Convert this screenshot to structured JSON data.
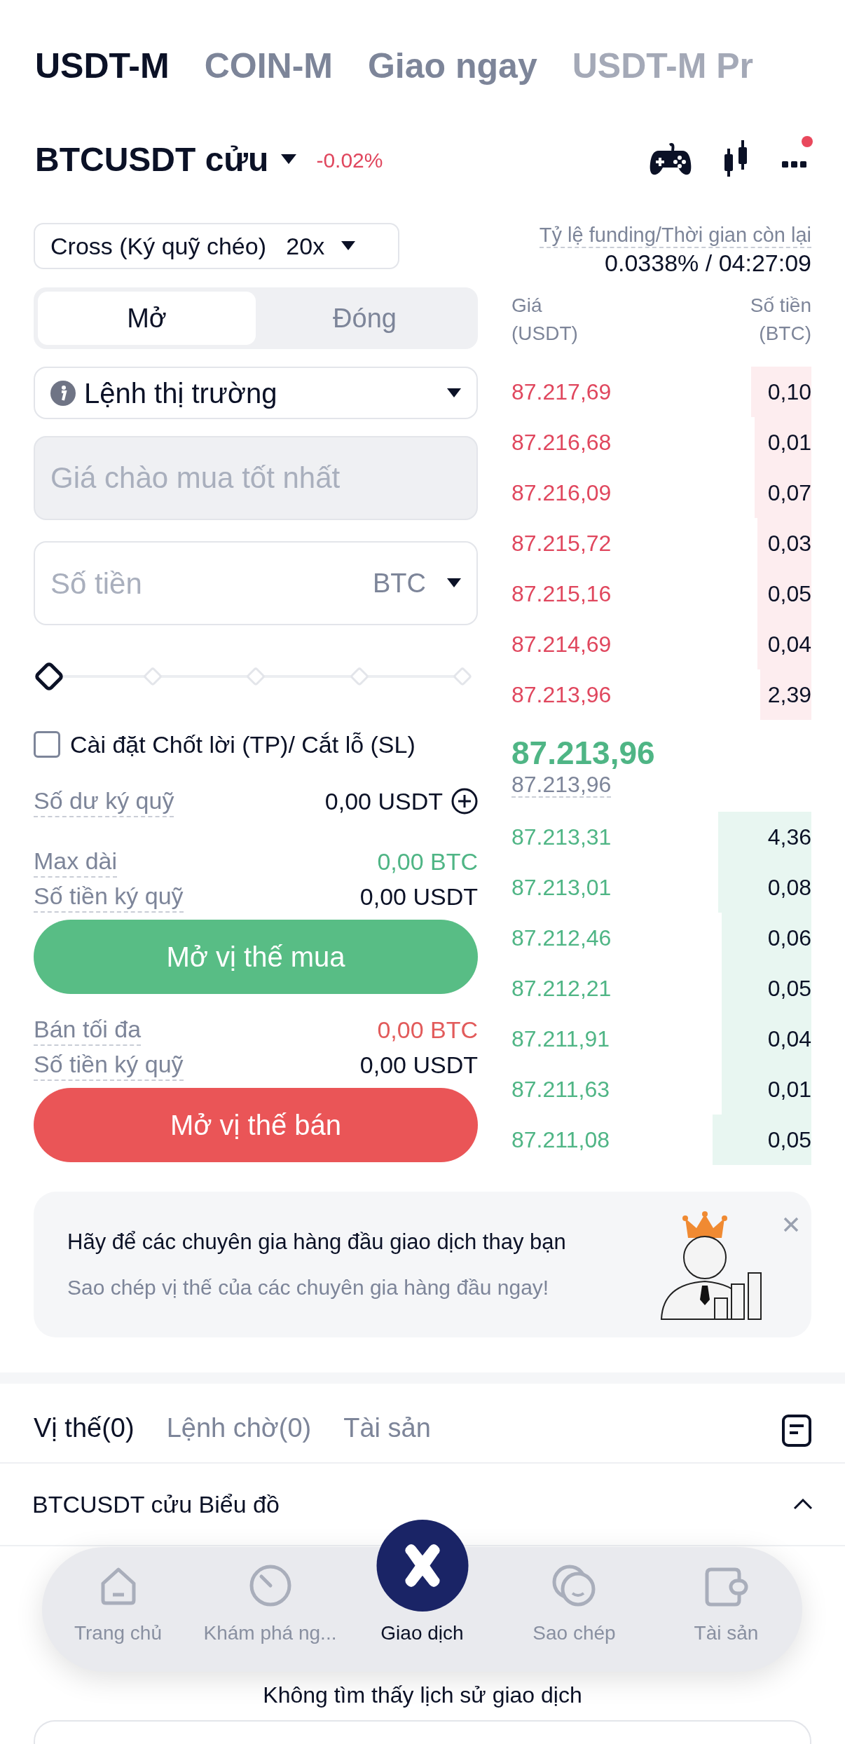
{
  "market_tabs": [
    {
      "label": "USDT-M",
      "selected": true
    },
    {
      "label": "COIN-M",
      "selected": false
    },
    {
      "label": "Giao ngay",
      "selected": false
    },
    {
      "label": "USDT-M Pr",
      "selected": false
    }
  ],
  "symbol": {
    "name": "BTCUSDT cửu",
    "change": "-0.02%"
  },
  "toolbar": {
    "notification_dot": true
  },
  "margin_mode": {
    "label": "Cross (Ký quỹ chéo)",
    "leverage": "20x"
  },
  "funding": {
    "label": "Tỷ lệ funding/Thời gian còn lại",
    "value": "0.0338% / 04:27:09"
  },
  "side_tabs": [
    {
      "label": "Mở",
      "selected": true
    },
    {
      "label": "Đóng",
      "selected": false
    }
  ],
  "order_type": "Lệnh thị trường",
  "price_field": {
    "placeholder": "Giá chào mua tốt nhất",
    "disabled": true
  },
  "amount_field": {
    "placeholder": "Số tiền",
    "unit": "BTC"
  },
  "slider": {
    "level": 0
  },
  "tp_sl": {
    "label": "Cài đặt Chốt lời (TP)/ Cắt lỗ (SL)",
    "checked": false
  },
  "balance": {
    "label": "Số dư ký quỹ",
    "value": "0,00 USDT"
  },
  "buy": {
    "max_label": "Max dài",
    "max_value": "0,00 BTC",
    "margin_label": "Số tiền ký quỹ",
    "margin_value": "0,00 USDT",
    "button": "Mở vị thế mua"
  },
  "sell": {
    "max_label": "Bán tối đa",
    "max_value": "0,00 BTC",
    "margin_label": "Số tiền ký quỹ",
    "margin_value": "0,00 USDT",
    "button": "Mở vị thế bán"
  },
  "order_book": {
    "price_header": "Giá",
    "price_unit": "(USDT)",
    "amount_header": "Số tiền",
    "amount_unit": "(BTC)",
    "asks": [
      {
        "price": "87.217,69",
        "amount": "0,10",
        "level": 0.2
      },
      {
        "price": "87.216,68",
        "amount": "0,01",
        "level": 0.19
      },
      {
        "price": "87.216,09",
        "amount": "0,07",
        "level": 0.19
      },
      {
        "price": "87.215,72",
        "amount": "0,03",
        "level": 0.18
      },
      {
        "price": "87.215,16",
        "amount": "0,05",
        "level": 0.18
      },
      {
        "price": "87.214,69",
        "amount": "0,04",
        "level": 0.18
      },
      {
        "price": "87.213,96",
        "amount": "2,39",
        "level": 0.17
      }
    ],
    "last_price": "87.213,96",
    "mark_price": "87.213,96",
    "bids": [
      {
        "price": "87.213,31",
        "amount": "4,36",
        "level": 0.31
      },
      {
        "price": "87.213,01",
        "amount": "0,08",
        "level": 0.31
      },
      {
        "price": "87.212,46",
        "amount": "0,06",
        "level": 0.3
      },
      {
        "price": "87.212,21",
        "amount": "0,05",
        "level": 0.3
      },
      {
        "price": "87.211,91",
        "amount": "0,04",
        "level": 0.3
      },
      {
        "price": "87.211,63",
        "amount": "0,01",
        "level": 0.3
      },
      {
        "price": "87.211,08",
        "amount": "0,05",
        "level": 0.33
      }
    ]
  },
  "banner": {
    "title": "Hãy để các chuyên gia hàng đầu giao dịch thay bạn",
    "subtitle": "Sao chép vị thế của các chuyên gia hàng đầu ngay!"
  },
  "position_tabs": [
    {
      "label": "Vị thế(0)",
      "selected": true
    },
    {
      "label": "Lệnh chờ(0)",
      "selected": false
    },
    {
      "label": "Tài sản",
      "selected": false
    }
  ],
  "chart_row": {
    "label": "BTCUSDT cửu Biểu đồ",
    "expanded": true
  },
  "empty_text": "Không tìm thấy lịch sử giao dịch",
  "bottom_nav": [
    {
      "kind": "home",
      "label": "Trang chủ",
      "selected": false
    },
    {
      "kind": "explore",
      "label": "Khám phá ng...",
      "selected": false
    },
    {
      "kind": "trade",
      "label": "Giao dịch",
      "selected": true
    },
    {
      "kind": "copy",
      "label": "Sao chép",
      "selected": false
    },
    {
      "kind": "wallet",
      "label": "Tài sản",
      "selected": false
    }
  ]
}
